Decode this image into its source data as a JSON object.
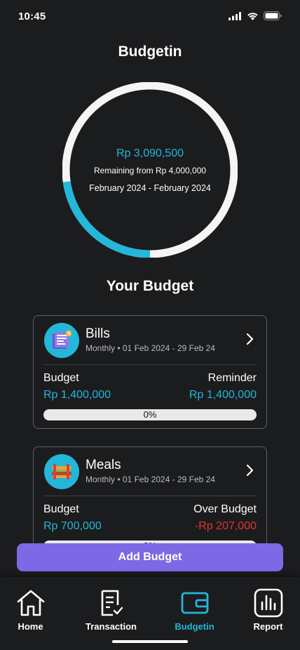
{
  "status_bar": {
    "time": "10:45"
  },
  "header": {
    "title": "Budgetin"
  },
  "summary": {
    "remaining_amount": "Rp 3,090,500",
    "remaining_caption": "Remaining from Rp 4,000,000",
    "period": "February 2024 - February 2024",
    "spent_fraction": 0.2274,
    "colors": {
      "track": "#f5f5f5",
      "spent": "#23b7d9"
    }
  },
  "section": {
    "title": "Your Budget"
  },
  "budgets": [
    {
      "name": "Bills",
      "icon": "bills-icon",
      "period": "Monthly • 01 Feb 2024 - 29 Feb 24",
      "left_label": "Budget",
      "left_value": "Rp 1,400,000",
      "right_label": "Reminder",
      "right_value": "Rp 1,400,000",
      "progress": "0%",
      "progress_fraction": 0
    },
    {
      "name": "Meals",
      "icon": "meals-icon",
      "period": "Monthly • 01 Feb 2024 - 29 Feb 24",
      "left_label": "Budget",
      "left_value": "Rp 700,000",
      "right_label": "Over Budget",
      "right_value": "-Rp 207,000",
      "progress": "0%",
      "progress_fraction": 0
    }
  ],
  "actions": {
    "add_budget": "Add Budget"
  },
  "nav": {
    "items": [
      {
        "label": "Home",
        "icon": "home-icon"
      },
      {
        "label": "Transaction",
        "icon": "transaction-icon"
      },
      {
        "label": "Budgetin",
        "icon": "wallet-icon",
        "active": true
      },
      {
        "label": "Report",
        "icon": "report-icon"
      }
    ]
  },
  "colors": {
    "accent": "#23b7d9",
    "primary_button": "#7d68e6",
    "negative": "#e0342f",
    "background": "#1b1c1e"
  }
}
